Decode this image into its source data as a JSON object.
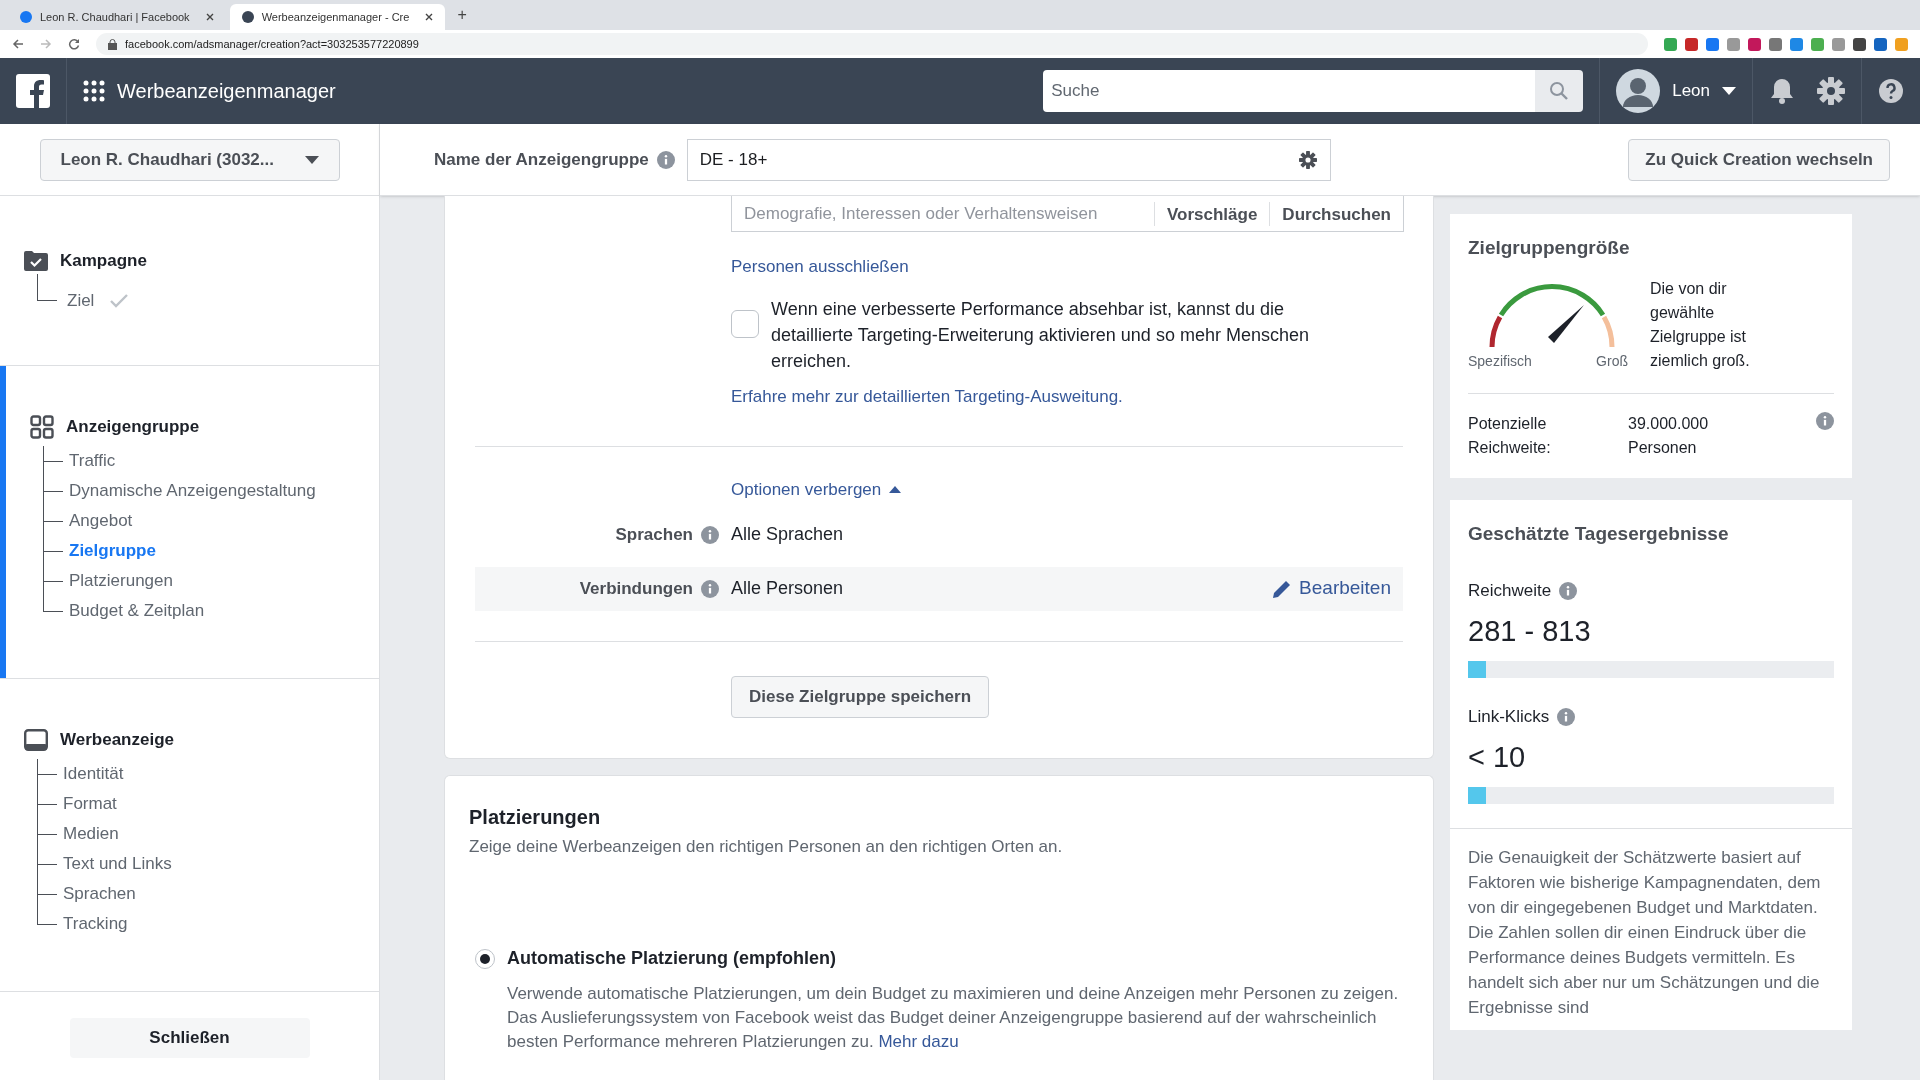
{
  "browser": {
    "tabs": [
      {
        "label": "Leon R. Chaudhari | Facebook",
        "selected": false
      },
      {
        "label": "Werbeanzeigenmanager - Cre",
        "selected": true
      }
    ],
    "new_tab": "+",
    "url": "facebook.com/adsmanager/creation?act=303253577220899"
  },
  "header": {
    "app_name": "Werbeanzeigenmanager",
    "search": {
      "placeholder": "Suche"
    },
    "user": "Leon"
  },
  "account_selector": "Leon R. Chaudhari (3032...",
  "sidebar": {
    "sections": [
      {
        "title": "Kampagne",
        "active": false,
        "items": [
          {
            "label": "Ziel",
            "selected": false,
            "completed": true
          }
        ]
      },
      {
        "title": "Anzeigengruppe",
        "active": true,
        "items": [
          {
            "label": "Traffic",
            "selected": false,
            "completed": false
          },
          {
            "label": "Dynamische Anzeigengestaltung",
            "selected": false,
            "completed": false
          },
          {
            "label": "Angebot",
            "selected": false,
            "completed": false
          },
          {
            "label": "Zielgruppe",
            "selected": true,
            "completed": false
          },
          {
            "label": "Platzierungen",
            "selected": false,
            "completed": false
          },
          {
            "label": "Budget & Zeitplan",
            "selected": false,
            "completed": false
          }
        ]
      },
      {
        "title": "Werbeanzeige",
        "active": false,
        "items": [
          {
            "label": "Identität",
            "selected": false,
            "completed": false
          },
          {
            "label": "Format",
            "selected": false,
            "completed": false
          },
          {
            "label": "Medien",
            "selected": false,
            "completed": false
          },
          {
            "label": "Text und Links",
            "selected": false,
            "completed": false
          },
          {
            "label": "Sprachen",
            "selected": false,
            "completed": false
          },
          {
            "label": "Tracking",
            "selected": false,
            "completed": false
          }
        ]
      }
    ],
    "close_button": "Schließen"
  },
  "adset_name": {
    "label": "Name der Anzeigengruppe",
    "value": "DE - 18+"
  },
  "quick_creation_button": "Zu Quick Creation wechseln",
  "audience": {
    "targeting_field": {
      "placeholder": "Demografie, Interessen oder Verhaltensweisen",
      "buttons": [
        "Vorschläge",
        "Durchsuchen"
      ]
    },
    "exclude_link": "Personen ausschließen",
    "expansion": {
      "checked": false,
      "text": "Wenn eine verbesserte Performance absehbar ist, kannst du die detaillierte Targeting-Erweiterung aktivieren und so mehr Menschen erreichen."
    },
    "learn_more_link": "Erfahre mehr zur detaillierten Targeting-Ausweitung.",
    "options_toggle": "Optionen verbergen",
    "rows": [
      {
        "label": "Sprachen",
        "value": "Alle Sprachen"
      },
      {
        "label": "Verbindungen",
        "value": "Alle Personen",
        "action": "Bearbeiten"
      }
    ],
    "save_button": "Diese Zielgruppe speichern"
  },
  "placements": {
    "title": "Platzierungen",
    "subtitle": "Zeige deine Werbeanzeigen den richtigen Personen an den richtigen Orten an.",
    "options": [
      {
        "label": "Automatische Platzierung (empfohlen)",
        "selected": true,
        "description": "Verwende automatische Platzierungen, um dein Budget zu maximieren und deine Anzeigen mehr Personen zu zeigen. Das Auslieferungssystem von Facebook weist das Budget deiner Anzeigengruppe basierend auf der wahrscheinlich besten Performance mehreren Platzierungen zu.",
        "link": "Mehr dazu"
      }
    ]
  },
  "audience_size": {
    "title": "Zielgruppengröße",
    "gauge_min": "Spezifisch",
    "gauge_max": "Groß",
    "summary": "Die von dir gewählte Zielgruppe ist ziemlich groß.",
    "reach_label": "Potenzielle Reichweite:",
    "reach_value": "39.000.000 Personen"
  },
  "daily_results": {
    "title": "Geschätzte Tagesergebnisse",
    "metrics": [
      {
        "label": "Reichweite",
        "value": "281 - 813",
        "level": 0.05
      },
      {
        "label": "Link-Klicks",
        "value": "< 10",
        "level": 0.05
      }
    ],
    "disclaimer": "Die Genauigkeit der Schätzwerte basiert auf Faktoren wie bisherige Kampagnendaten, dem von dir eingegebenen Budget und Marktdaten. Die Zahlen sollen dir einen Eindruck über die Performance deines Budgets vermitteln. Es handelt sich aber nur um Schätzungen und die Ergebnisse sind"
  }
}
